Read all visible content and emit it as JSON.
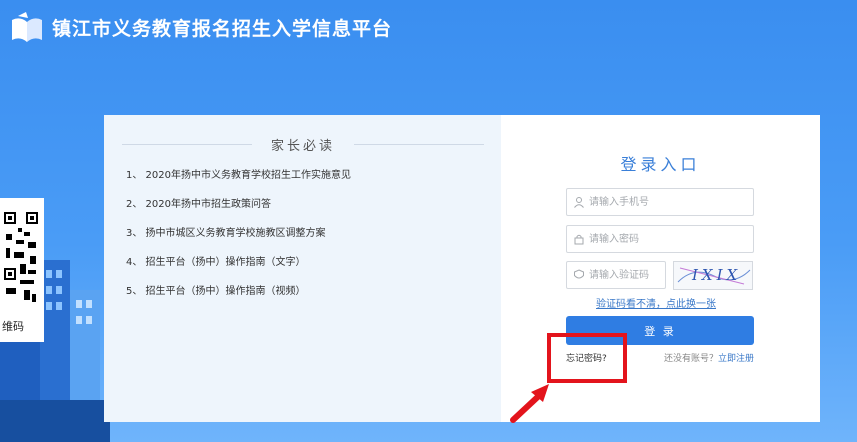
{
  "header": {
    "site_title": "镇江市义务教育报名招生入学信息平台"
  },
  "side": {
    "qr_caption": "维码"
  },
  "notice": {
    "title": "家长必读",
    "items": [
      "1、 2020年扬中市义务教育学校招生工作实施意见",
      "2、 2020年扬中市招生政策问答",
      "3、 扬中市城区义务教育学校施教区调整方案",
      "4、 招生平台（扬中）操作指南（文字）",
      "5、 招生平台（扬中）操作指南（视频）"
    ]
  },
  "login": {
    "title": "登录入口",
    "phone_placeholder": "请输入手机号",
    "password_placeholder": "请输入密码",
    "captcha_placeholder": "请输入验证码",
    "captcha_text": "IXIX",
    "refresh_link": "验证码看不清，点此换一张",
    "login_button": "登 录",
    "forgot_password": "忘记密码?",
    "no_account": "还没有账号？",
    "register_link": "立即注册"
  },
  "colors": {
    "background": "#3a8ef0",
    "accent": "#2f7de3",
    "highlight": "#e3141c"
  }
}
